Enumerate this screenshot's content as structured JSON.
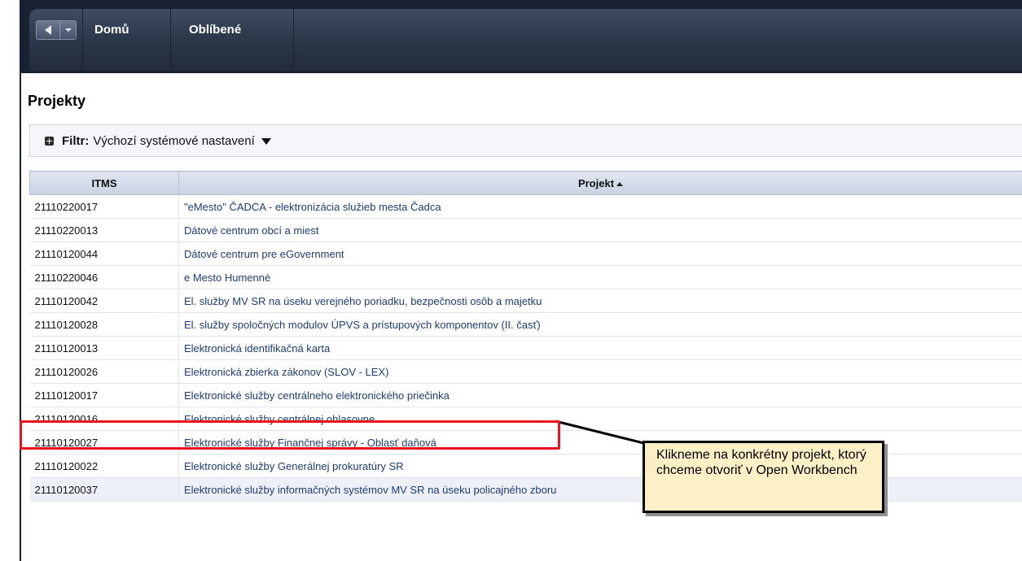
{
  "topbar": {
    "nav_items": [
      "Domů",
      "Oblíbené"
    ]
  },
  "page": {
    "title": "Projekty"
  },
  "filter": {
    "label": "Filtr:",
    "value": "Výchozí systémové nastavení"
  },
  "table": {
    "columns": [
      "ITMS",
      "Projekt"
    ],
    "sorted_column": "Projekt",
    "sort_direction": "ascending",
    "rows": [
      {
        "itms": "21110220017",
        "projekt": "\"eMesto\" ČADCA - elektronizácia služieb mesta Čadca"
      },
      {
        "itms": "21110220013",
        "projekt": "Dátové centrum obcí a miest"
      },
      {
        "itms": "21110120044",
        "projekt": "Dátové centrum pre eGovernment"
      },
      {
        "itms": "21110220046",
        "projekt": "e Mesto Humenné"
      },
      {
        "itms": "21110120042",
        "projekt": "El. služby MV SR na úseku verejného poriadku, bezpečnosti osôb a majetku"
      },
      {
        "itms": "21110120028",
        "projekt": "El. služby spoločných modulov ÚPVS a prístupových komponentov (II. časť)"
      },
      {
        "itms": "21110120013",
        "projekt": "Elektronická identifikačná karta"
      },
      {
        "itms": "21110120026",
        "projekt": "Elektronická zbierka zákonov (SLOV - LEX)"
      },
      {
        "itms": "21110120017",
        "projekt": "Elektronické služby centrálneho elektronického priečinka"
      },
      {
        "itms": "21110120016",
        "projekt": "Elektronické služby centrálnej ohlasovne"
      },
      {
        "itms": "21110120027",
        "projekt": "Elektronické služby Finančnej správy - Oblasť daňová"
      },
      {
        "itms": "21110120022",
        "projekt": "Elektronické služby Generálnej prokuratúry SR"
      },
      {
        "itms": "21110120037",
        "projekt": "Elektronické služby informačných systémov MV SR na úseku policajného zboru"
      }
    ]
  },
  "annotation": {
    "callout_text": "Klikneme na konkrétny projekt, ktorý chceme otvoriť v Open Workbench",
    "highlight_color": "#e8131b",
    "callout_bg": "#fdf0c6"
  }
}
